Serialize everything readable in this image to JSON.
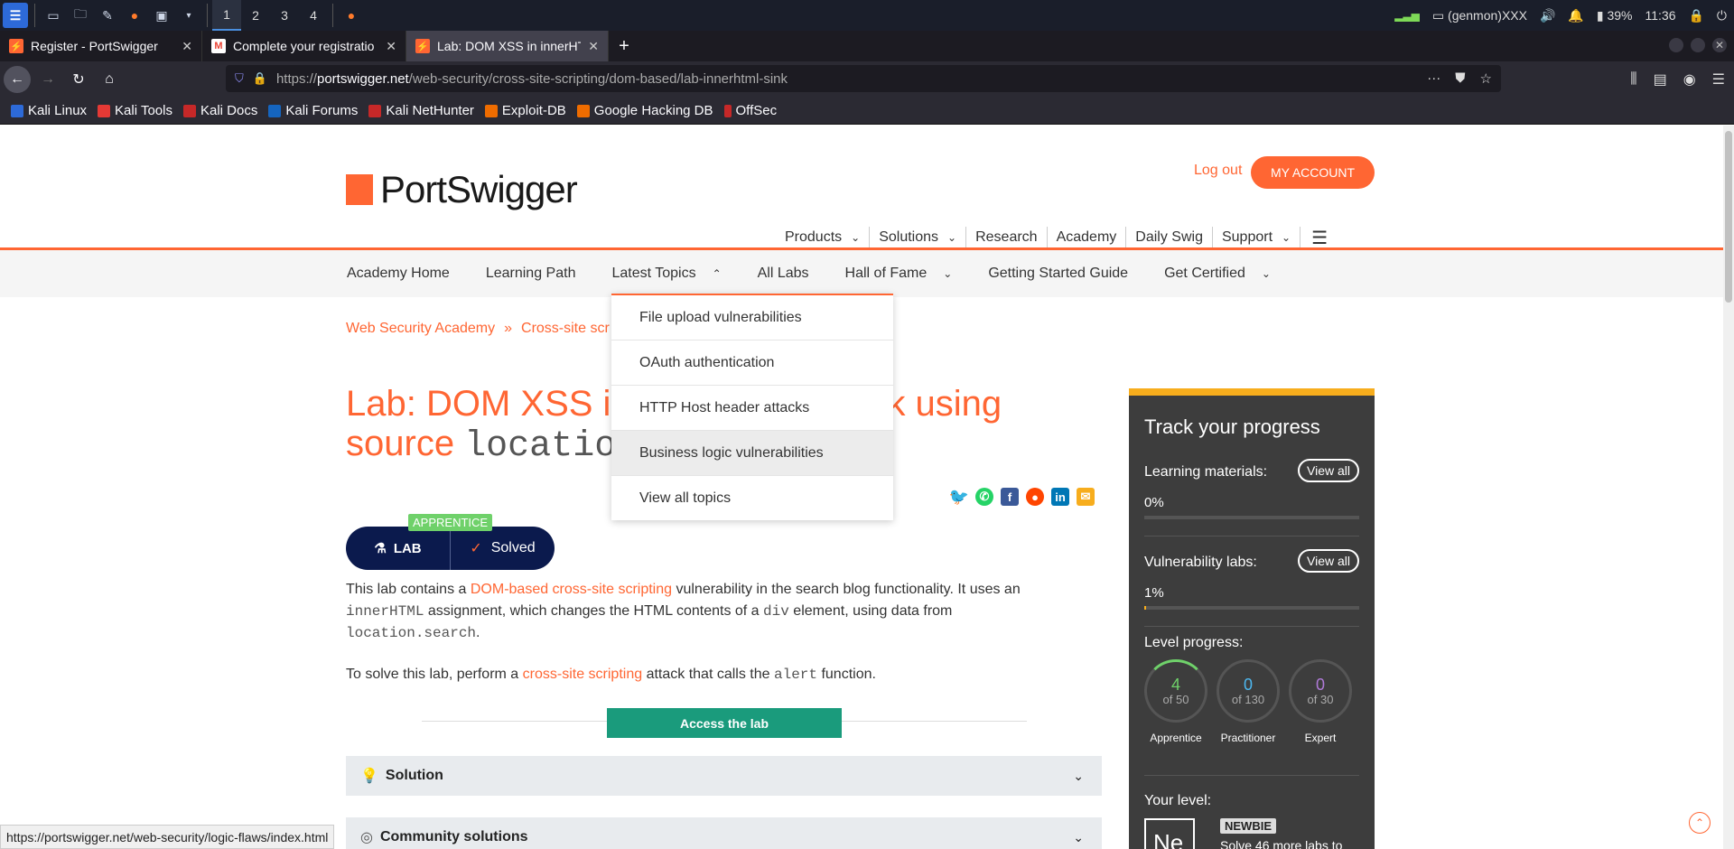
{
  "os": {
    "workspaces": [
      "1",
      "2",
      "3",
      "4"
    ],
    "status_user": "(genmon)XXX",
    "battery": "39%",
    "clock": "11:36"
  },
  "browser": {
    "tabs": [
      {
        "title": "Register - PortSwigger",
        "fav_color": "#ff6633"
      },
      {
        "title": "Complete your registratio",
        "fav_color": "#ea4335"
      },
      {
        "title": "Lab: DOM XSS in innerHT",
        "fav_color": "#ff6633"
      }
    ],
    "url_prefix": "https://",
    "url_host": "portswigger.net",
    "url_path": "/web-security/cross-site-scripting/dom-based/lab-innerhtml-sink",
    "bookmarks": [
      {
        "label": "Kali Linux",
        "color": "#2d6ad8"
      },
      {
        "label": "Kali Tools",
        "color": "#e53935"
      },
      {
        "label": "Kali Docs",
        "color": "#c62828"
      },
      {
        "label": "Kali Forums",
        "color": "#1565c0"
      },
      {
        "label": "Kali NetHunter",
        "color": "#c62828"
      },
      {
        "label": "Exploit-DB",
        "color": "#ef6c00"
      },
      {
        "label": "Google Hacking DB",
        "color": "#ef6c00"
      },
      {
        "label": "OffSec",
        "color": "#c62828"
      }
    ]
  },
  "site": {
    "logo": "PortSwigger",
    "logout": "Log out",
    "my_account": "MY ACCOUNT",
    "main_nav": [
      "Products",
      "Solutions",
      "Research",
      "Academy",
      "Daily Swig",
      "Support"
    ],
    "sub_nav": [
      "Academy Home",
      "Learning Path",
      "Latest Topics",
      "All Labs",
      "Hall of Fame",
      "Getting Started Guide",
      "Get Certified"
    ],
    "dropdown": [
      "File upload vulnerabilities",
      "OAuth authentication",
      "HTTP Host header attacks",
      "Business logic vulnerabilities",
      "View all topics"
    ],
    "breadcrumbs": [
      "Web Security Academy",
      "Cross-site scr"
    ],
    "title_line1": "Lab: DOM XSS i",
    "title_line1_end": "k using",
    "title_line2_a": "source ",
    "title_line2_mono": "locatio",
    "badge_level": "APPRENTICE",
    "badge_lab": "LAB",
    "badge_status": "Solved",
    "p1_a": "This lab contains a ",
    "p1_link": "DOM-based cross-site scripting",
    "p1_b": " vulnerability in the search blog functionality. It uses an",
    "p1_code1": "innerHTML",
    "p1_c": " assignment, which changes the HTML contents of a ",
    "p1_code2": "div",
    "p1_d": " element, using data from",
    "p1_code3": "location.search",
    "p1_e": ".",
    "p2_a": "To solve this lab, perform a ",
    "p2_link": "cross-site scripting",
    "p2_b": " attack that calls the ",
    "p2_code": "alert",
    "p2_c": " function.",
    "access": "Access the lab",
    "solution": "Solution",
    "community": "Community solutions"
  },
  "progress": {
    "title": "Track your progress",
    "learning_label": "Learning materials:",
    "learning_pct": "0%",
    "learning_value": 0,
    "vuln_label": "Vulnerability labs:",
    "vuln_pct": "1%",
    "vuln_value": 1,
    "view_all": "View all",
    "level_label": "Level progress:",
    "rings": [
      {
        "num": "4",
        "of": "of 50",
        "name": "Apprentice",
        "color": "#6fd16a"
      },
      {
        "num": "0",
        "of": "of 130",
        "name": "Practitioner",
        "color": "#4db8f0"
      },
      {
        "num": "0",
        "of": "of 30",
        "name": "Expert",
        "color": "#b07ad8"
      }
    ],
    "your_level": "Your level:",
    "level_code": "Ne",
    "level_name": "NEWBIE",
    "solve_more": "Solve 46 more labs to"
  },
  "statusbar": "https://portswigger.net/web-security/logic-flaws/index.html"
}
